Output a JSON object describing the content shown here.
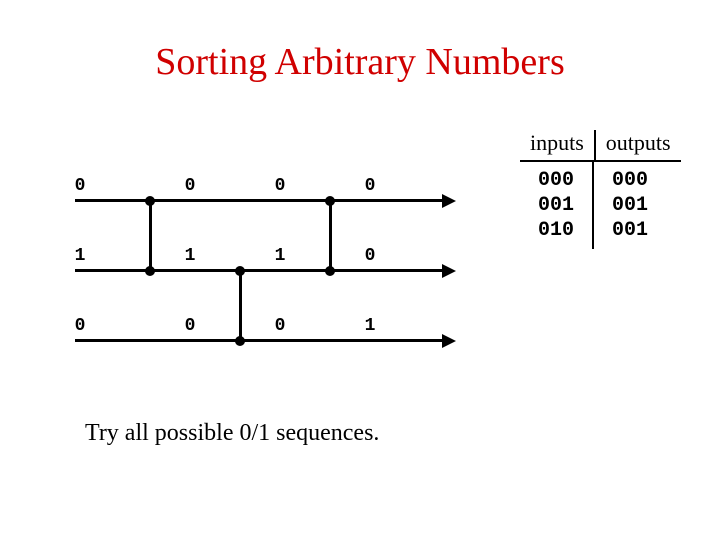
{
  "title": "Sorting Arbitrary Numbers",
  "caption": "Try all possible 0/1 sequences.",
  "network": {
    "wire_values": {
      "w0": [
        "0",
        "0",
        "0",
        "0"
      ],
      "w1": [
        "1",
        "1",
        "1",
        "0"
      ],
      "w2": [
        "0",
        "0",
        "0",
        "1"
      ]
    }
  },
  "io": {
    "header_inputs": "inputs",
    "header_outputs": "outputs",
    "inputs": [
      "000",
      "001",
      "010"
    ],
    "outputs": [
      "000",
      "001",
      "001"
    ]
  }
}
